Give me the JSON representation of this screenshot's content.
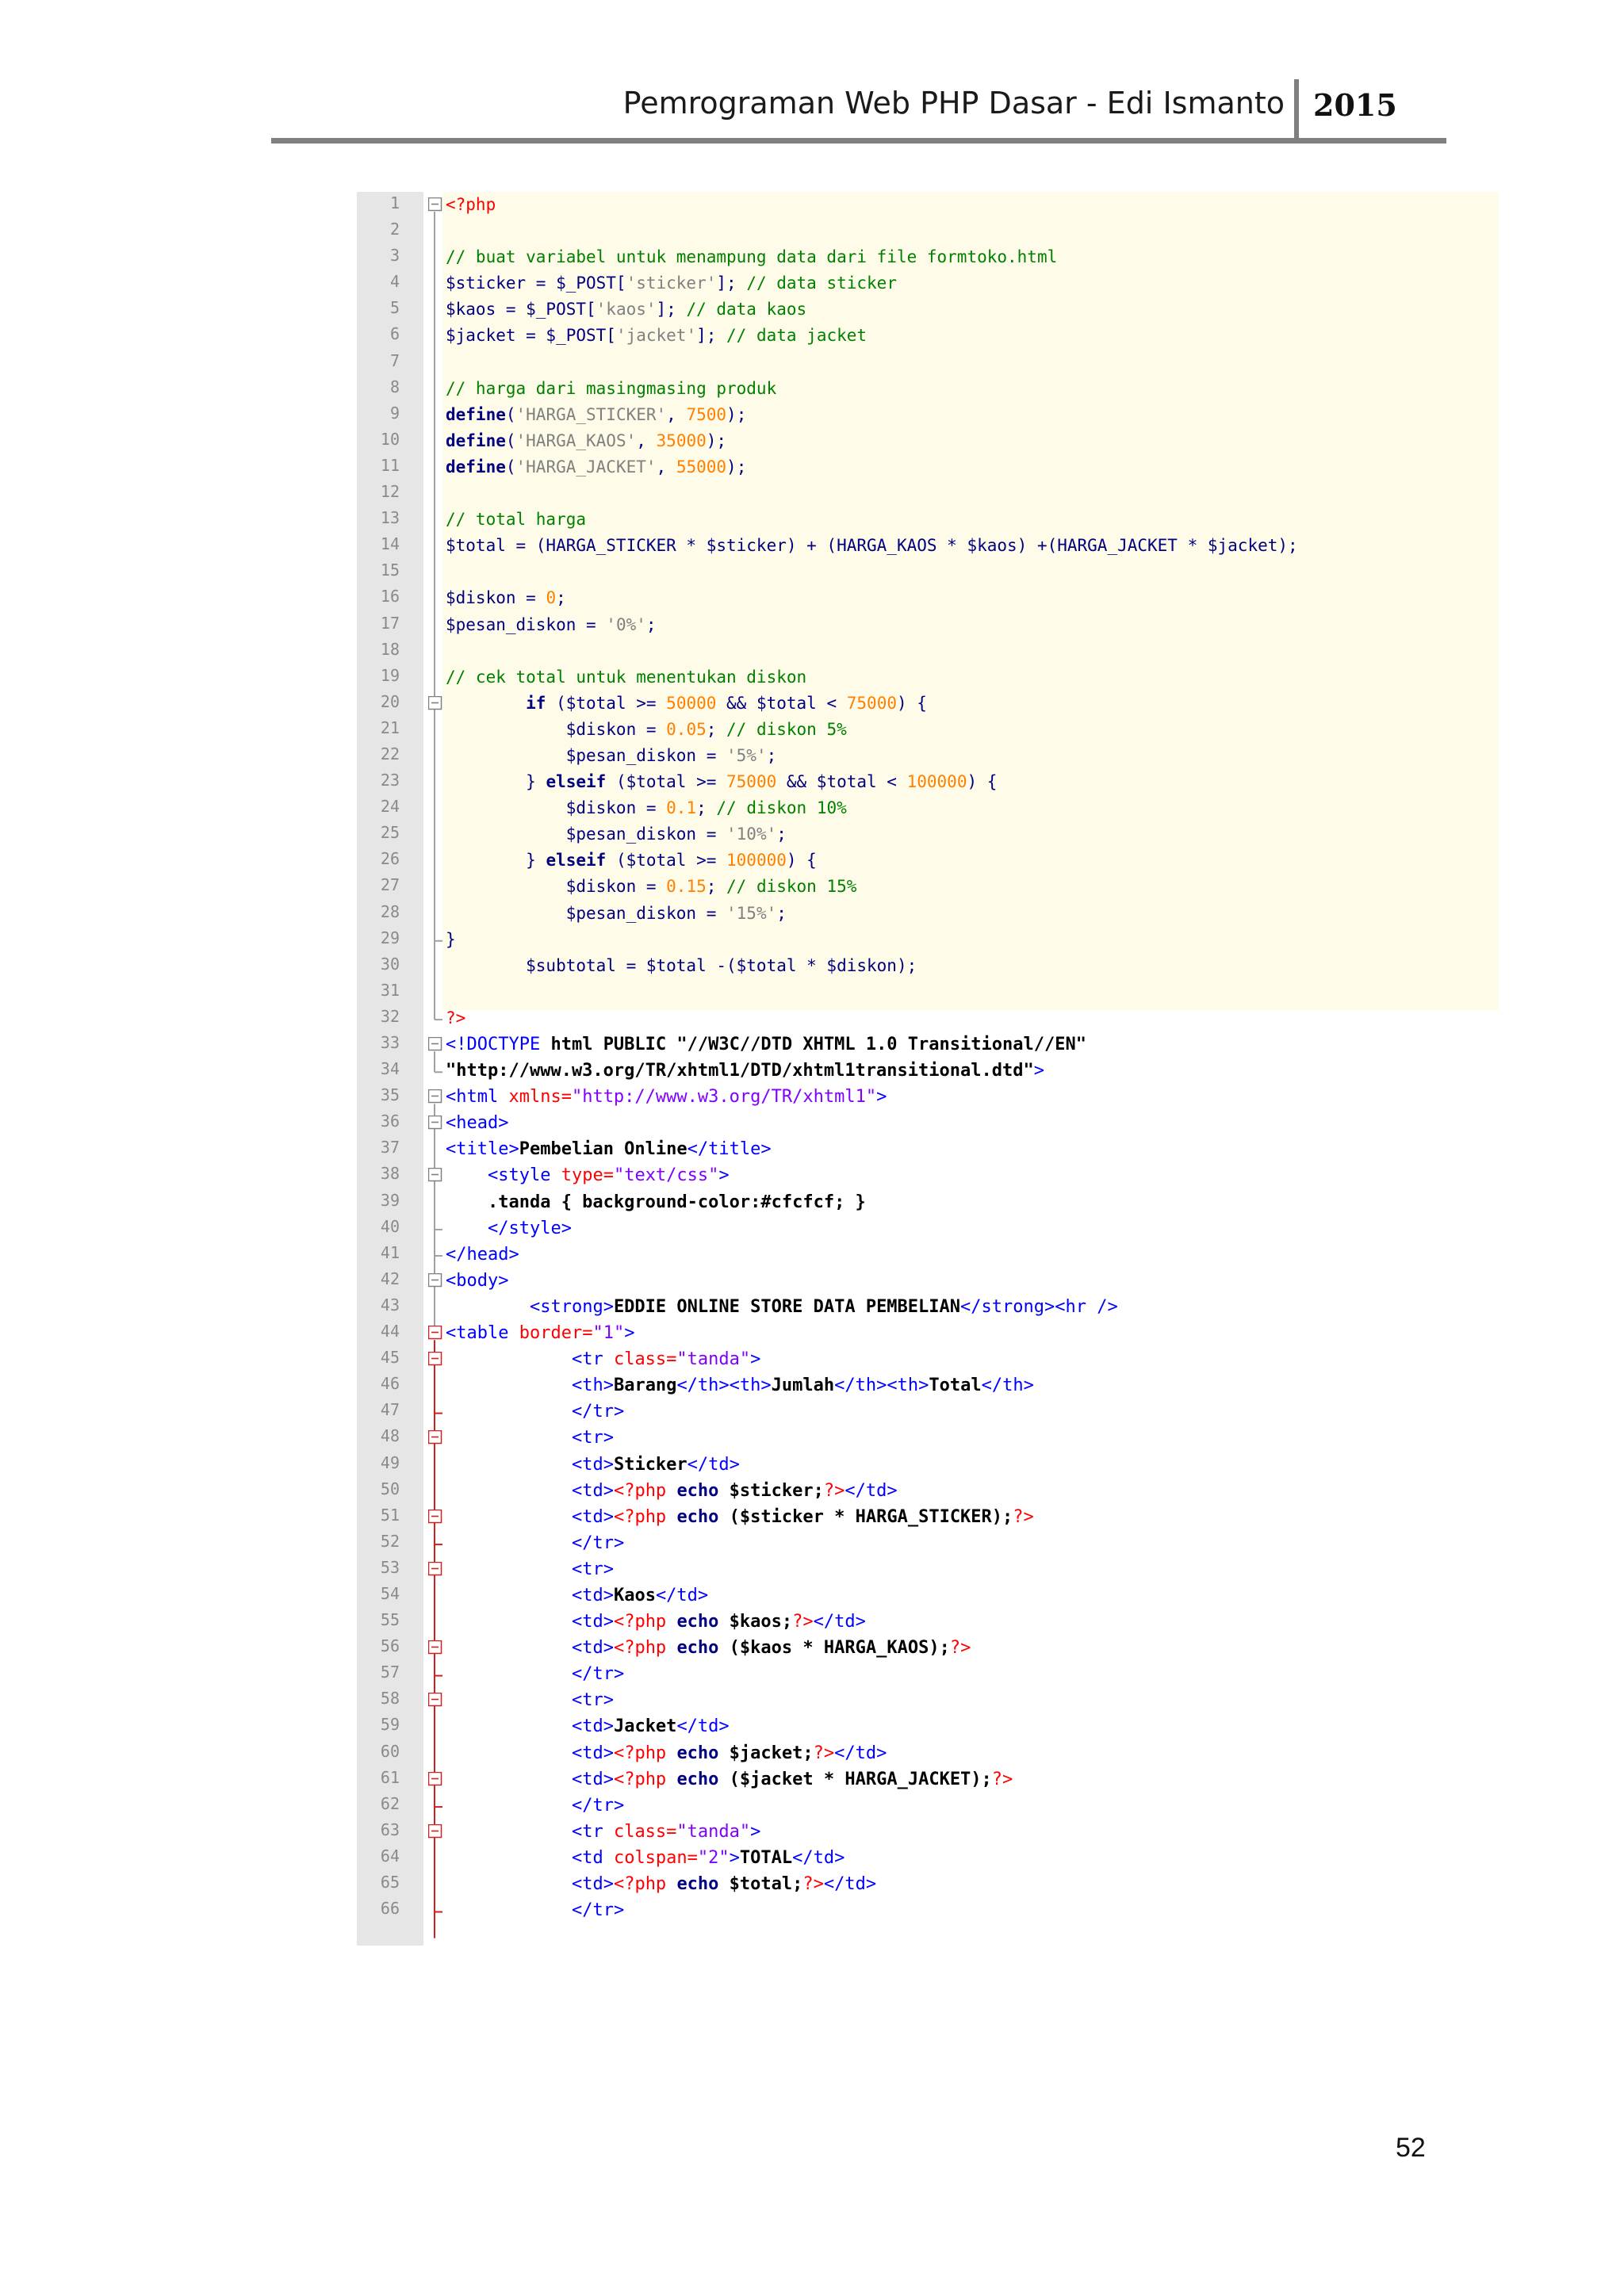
{
  "header": {
    "title": "Pemrograman Web PHP Dasar - Edi Ismanto",
    "year": "2015"
  },
  "page_number": "52",
  "code": {
    "lines": [
      {
        "n": "1",
        "text": "<?php"
      },
      {
        "n": "2",
        "text": ""
      },
      {
        "n": "3",
        "text": "// buat variabel untuk menampung data dari file formtoko.html"
      },
      {
        "n": "4",
        "text": "$sticker = $_POST['sticker']; // data sticker"
      },
      {
        "n": "5",
        "text": "$kaos = $_POST['kaos']; // data kaos"
      },
      {
        "n": "6",
        "text": "$jacket = $_POST['jacket']; // data jacket"
      },
      {
        "n": "7",
        "text": ""
      },
      {
        "n": "8",
        "text": "// harga dari masingmasing produk"
      },
      {
        "n": "9",
        "text": "define('HARGA_STICKER', 7500);"
      },
      {
        "n": "10",
        "text": "define('HARGA_KAOS', 35000);"
      },
      {
        "n": "11",
        "text": "define('HARGA_JACKET', 55000);"
      },
      {
        "n": "12",
        "text": ""
      },
      {
        "n": "13",
        "text": "// total harga"
      },
      {
        "n": "14",
        "text": "$total = (HARGA_STICKER * $sticker) + (HARGA_KAOS * $kaos) +(HARGA_JACKET * $jacket);"
      },
      {
        "n": "15",
        "text": ""
      },
      {
        "n": "16",
        "text": "$diskon = 0;"
      },
      {
        "n": "17",
        "text": "$pesan_diskon = '0%';"
      },
      {
        "n": "18",
        "text": ""
      },
      {
        "n": "19",
        "text": "// cek total untuk menentukan diskon"
      },
      {
        "n": "20",
        "text": "        if ($total >= 50000 && $total < 75000) {"
      },
      {
        "n": "21",
        "text": "            $diskon = 0.05; // diskon 5%"
      },
      {
        "n": "22",
        "text": "            $pesan_diskon = '5%';"
      },
      {
        "n": "23",
        "text": "        } elseif ($total >= 75000 && $total < 100000) {"
      },
      {
        "n": "24",
        "text": "            $diskon = 0.1; // diskon 10%"
      },
      {
        "n": "25",
        "text": "            $pesan_diskon = '10%';"
      },
      {
        "n": "26",
        "text": "        } elseif ($total >= 100000) {"
      },
      {
        "n": "27",
        "text": "            $diskon = 0.15; // diskon 15%"
      },
      {
        "n": "28",
        "text": "            $pesan_diskon = '15%';"
      },
      {
        "n": "29",
        "text": "}"
      },
      {
        "n": "30",
        "text": "        $subtotal = $total -($total * $diskon);"
      },
      {
        "n": "31",
        "text": ""
      },
      {
        "n": "32",
        "text": "?>"
      },
      {
        "n": "33",
        "text": "<!DOCTYPE html PUBLIC \"//W3C//DTD XHTML 1.0 Transitional//EN\""
      },
      {
        "n": "34",
        "text": "\"http://www.w3.org/TR/xhtml1/DTD/xhtml1transitional.dtd\">"
      },
      {
        "n": "35",
        "text": "<html xmlns=\"http://www.w3.org/TR/xhtml1\">"
      },
      {
        "n": "36",
        "text": "<head>"
      },
      {
        "n": "37",
        "text": "<title>Pembelian Online</title>"
      },
      {
        "n": "38",
        "text": "    <style type=\"text/css\">"
      },
      {
        "n": "39",
        "text": "    .tanda { background-color:#cfcfcf; }"
      },
      {
        "n": "40",
        "text": "    </style>"
      },
      {
        "n": "41",
        "text": "</head>"
      },
      {
        "n": "42",
        "text": "<body>"
      },
      {
        "n": "43",
        "text": "        <strong>EDDIE ONLINE STORE DATA PEMBELIAN</strong><hr />"
      },
      {
        "n": "44",
        "text": "<table border=\"1\">"
      },
      {
        "n": "45",
        "text": "            <tr class=\"tanda\">"
      },
      {
        "n": "46",
        "text": "            <th>Barang</th><th>Jumlah</th><th>Total</th>"
      },
      {
        "n": "47",
        "text": "            </tr>"
      },
      {
        "n": "48",
        "text": "            <tr>"
      },
      {
        "n": "49",
        "text": "            <td>Sticker</td>"
      },
      {
        "n": "50",
        "text": "            <td><?php echo $sticker;?></td>"
      },
      {
        "n": "51",
        "text": "            <td><?php echo ($sticker * HARGA_STICKER);?>"
      },
      {
        "n": "52",
        "text": "            </tr>"
      },
      {
        "n": "53",
        "text": "            <tr>"
      },
      {
        "n": "54",
        "text": "            <td>Kaos</td>"
      },
      {
        "n": "55",
        "text": "            <td><?php echo $kaos;?></td>"
      },
      {
        "n": "56",
        "text": "            <td><?php echo ($kaos * HARGA_KAOS);?>"
      },
      {
        "n": "57",
        "text": "            </tr>"
      },
      {
        "n": "58",
        "text": "            <tr>"
      },
      {
        "n": "59",
        "text": "            <td>Jacket</td>"
      },
      {
        "n": "60",
        "text": "            <td><?php echo $jacket;?></td>"
      },
      {
        "n": "61",
        "text": "            <td><?php echo ($jacket * HARGA_JACKET);?>"
      },
      {
        "n": "62",
        "text": "            </tr>"
      },
      {
        "n": "63",
        "text": "            <tr class=\"tanda\">"
      },
      {
        "n": "64",
        "text": "            <td colspan=\"2\">TOTAL</td>"
      },
      {
        "n": "65",
        "text": "            <td><?php echo $total;?></td>"
      },
      {
        "n": "66",
        "text": "            </tr>"
      }
    ]
  }
}
